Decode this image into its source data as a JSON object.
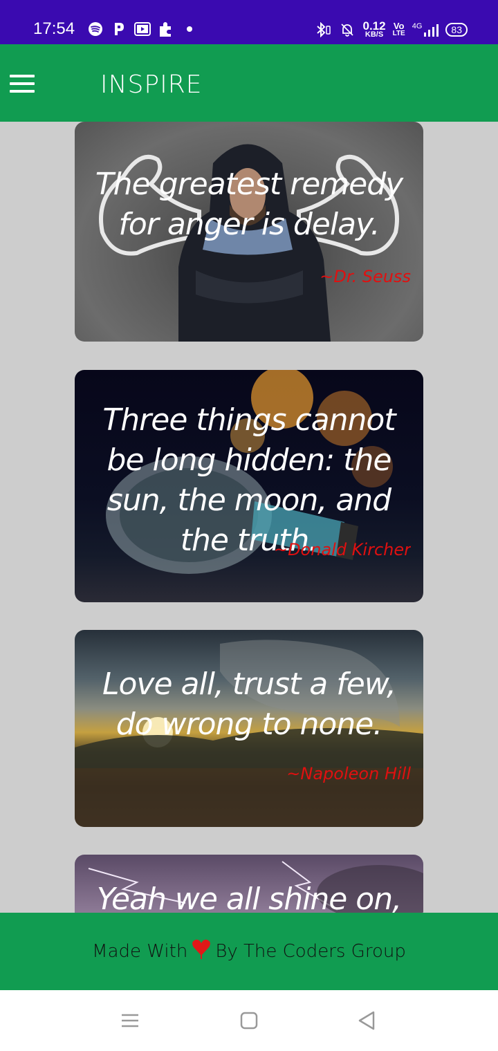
{
  "status_bar": {
    "time": "17:54",
    "speed_value": "0.12",
    "speed_unit": "KB/S",
    "volte_top": "Vo",
    "volte_bottom": "LTE",
    "network": "4G",
    "battery": "83",
    "left_icons": [
      "spotify-icon",
      "p-app-icon",
      "youtube-icon",
      "puzzle-icon",
      "dot-icon"
    ],
    "right_icons": [
      "bluetooth-icon",
      "bell-off-icon",
      "signal-icon"
    ]
  },
  "app_bar": {
    "title": "INSPIRE",
    "menu_icon": "hamburger-menu-icon",
    "color": "#119c51"
  },
  "quotes": [
    {
      "text": "The greatest remedy for anger is delay.",
      "author": "~Dr. Seuss"
    },
    {
      "text": "Three things cannot be long hidden: the sun, the moon, and the truth.",
      "author": "~Donald Kircher"
    },
    {
      "text": "Love all, trust a few, do wrong to none.",
      "author": "~Napoleon Hill"
    },
    {
      "text": "Yeah we all shine on,",
      "author": ""
    }
  ],
  "footer": {
    "prefix": "Made With",
    "heart_icon": "heart-icon",
    "suffix": "By The Coders Group"
  },
  "nav_bar": {
    "icons": [
      "recent-apps-icon",
      "home-icon",
      "back-icon"
    ]
  },
  "colors": {
    "status_bar": "#3a0ab0",
    "app_bar": "#119c51",
    "background": "#cdcdcd",
    "author_text": "#e01010"
  }
}
